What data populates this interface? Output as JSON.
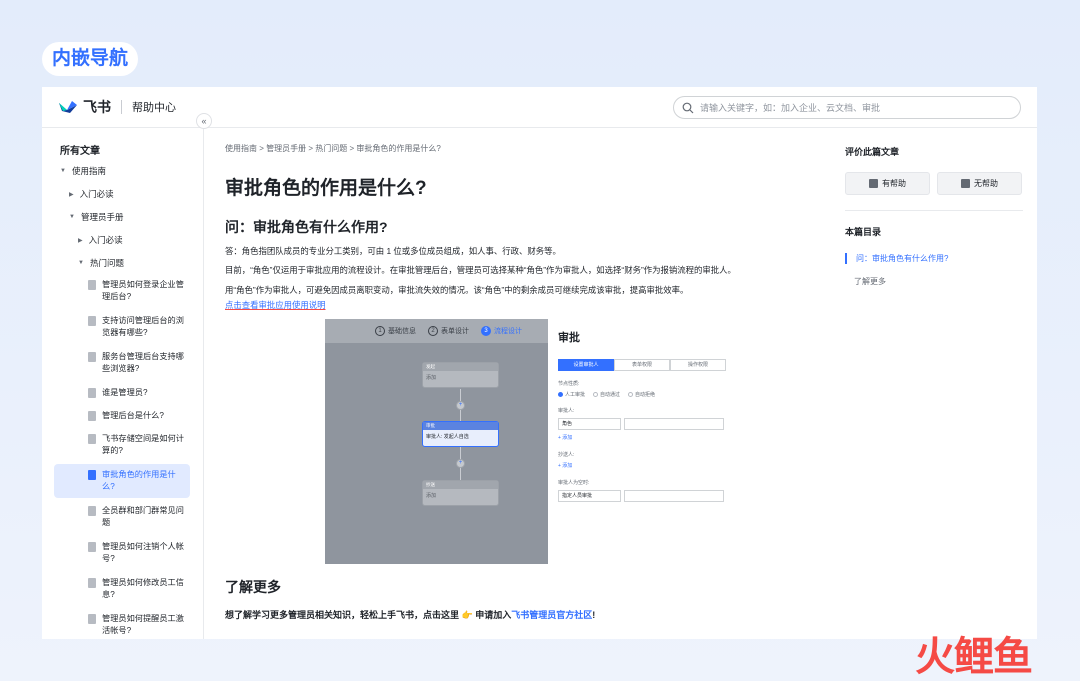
{
  "badge": "内嵌导航",
  "header": {
    "brand": "飞书",
    "help_center": "帮助中心",
    "search_placeholder": "请输入关键字，如：加入企业、云文档、审批"
  },
  "sidebar": {
    "title": "所有文章",
    "collapse_glyph": "«",
    "nav": [
      {
        "label": "使用指南",
        "expanded": true
      },
      {
        "label": "入门必读",
        "expanded": false
      },
      {
        "label": "管理员手册",
        "expanded": true
      },
      {
        "label": "入门必读",
        "expanded": false
      },
      {
        "label": "热门问题",
        "expanded": true
      }
    ],
    "docs": [
      "管理员如何登录企业管理后台?",
      "支持访问管理后台的浏览器有哪些?",
      "服务台管理后台支持哪些浏览器?",
      "谁是管理员?",
      "管理后台是什么?",
      "飞书存储空间是如何计算的?",
      "审批角色的作用是什么?",
      "全员群和部门群常见问题",
      "管理员如何注销个人帐号?",
      "管理员如何修改员工信息?",
      "管理员如何提醒员工激活帐号?"
    ],
    "active_index": 6
  },
  "main": {
    "breadcrumb": "使用指南 > 管理员手册 > 热门问题 > 审批角色的作用是什么?",
    "title": "审批角色的作用是什么?",
    "question": "问：审批角色有什么作用?",
    "p1": "答：角色指团队成员的专业分工类别，可由 1 位或多位成员组成，如人事、行政、财务等。",
    "p2": "目前，“角色”仅运用于审批应用的流程设计。在审批管理后台，管理员可选择某种“角色”作为审批人，如选择“财务”作为报销流程的审批人。",
    "p3": "用“角色”作为审批人，可避免因成员离职变动，审批流失效的情况。该“角色”中的剩余成员可继续完成该审批，提高审批效率。",
    "p3_link": "点击查看审批应用使用说明",
    "screenshot": {
      "steps": [
        "基础信息",
        "表单设计",
        "流程设计"
      ],
      "step_numbers": [
        "1",
        "2",
        "3"
      ],
      "node1_header": "发起",
      "node1_body": "添加",
      "node2_header": "审批",
      "node2_body": "审批人: 发起人自选",
      "node3_header": "抄送",
      "node3_body": "添加",
      "panel_title": "审批",
      "panel_tabs": [
        "设置审批人",
        "表单权限",
        "操作权限"
      ],
      "node_type_label": "节点性质:",
      "node_types": [
        "人工审批",
        "自动通过",
        "自动拒绝"
      ],
      "approver_label": "审批人:",
      "approver_select": "角色",
      "add_label": "+ 添加",
      "cc_label": "抄送人:",
      "empty_label": "审批人为空时:",
      "empty_select": "指定人员审批"
    },
    "learn_more_title": "了解更多",
    "learn_more_text": "想了解学习更多管理员相关知识，轻松上手飞书，点击这里 👉 申请加入",
    "learn_more_link": "飞书管理员官方社区",
    "learn_more_end": "!"
  },
  "right": {
    "rate_title": "评价此篇文章",
    "helpful": "有帮助",
    "not_helpful": "无帮助",
    "toc_title": "本篇目录",
    "toc": [
      "问：审批角色有什么作用?",
      "了解更多"
    ]
  },
  "watermark": "火鲤鱼",
  "colors": {
    "accent": "#3370ff",
    "watermark": "#f54a45"
  }
}
